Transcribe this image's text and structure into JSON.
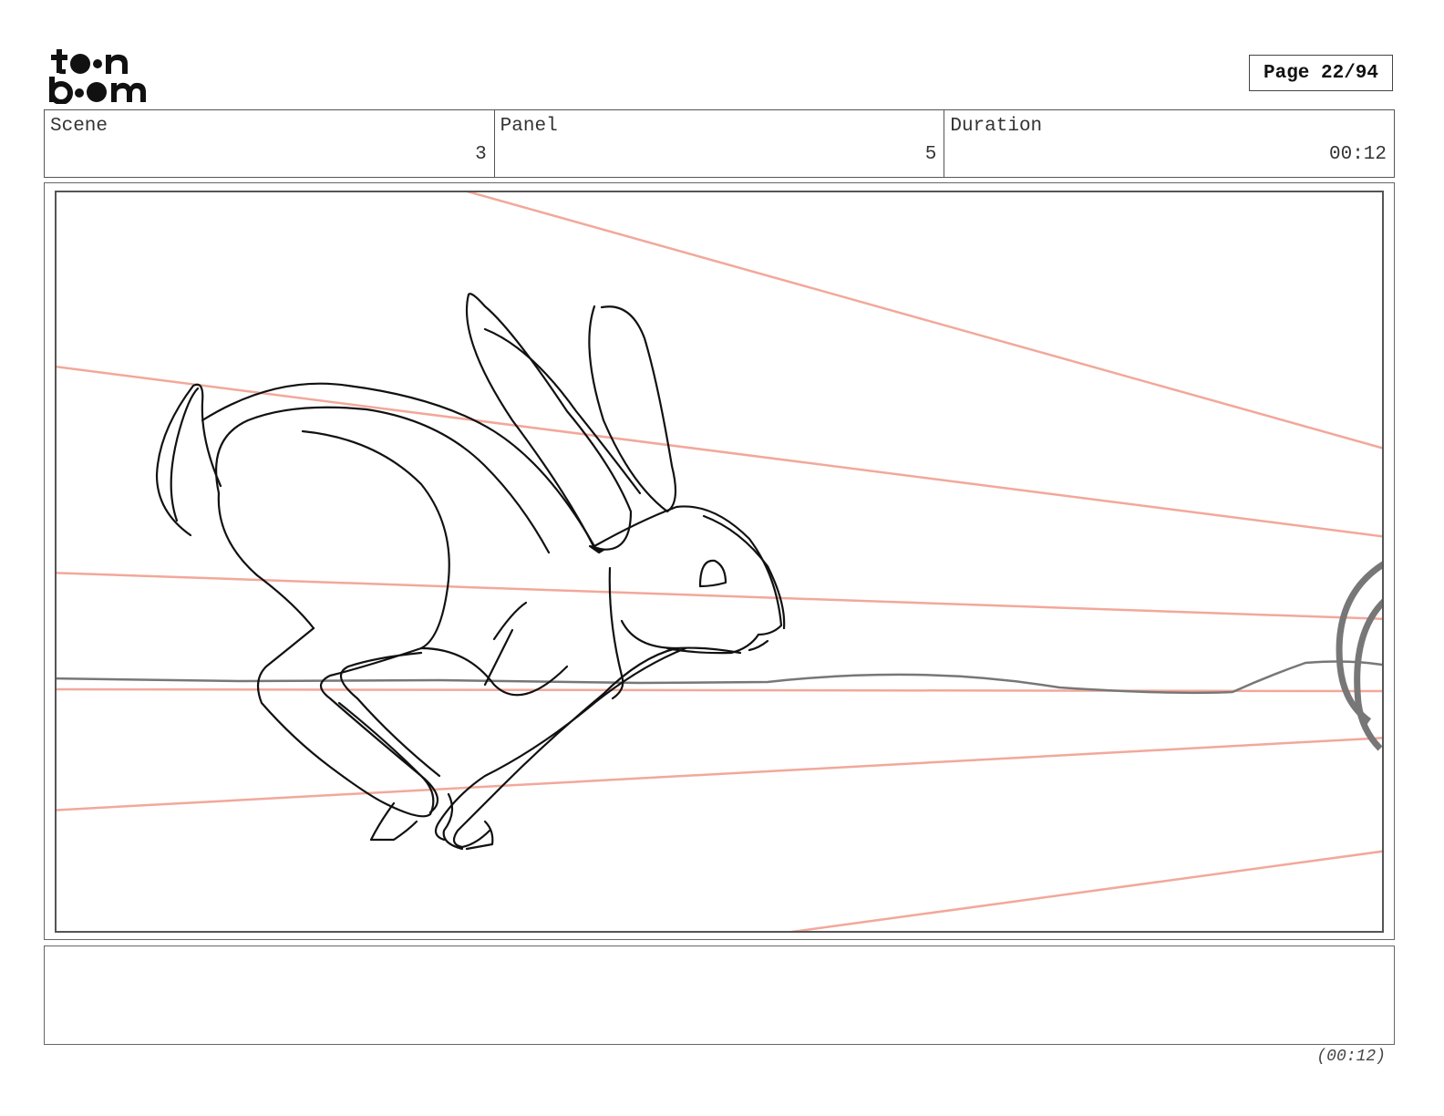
{
  "header": {
    "logo_text": "toon boom",
    "page_label": "Page 22/94"
  },
  "info": {
    "scene_label": "Scene",
    "scene_value": "3",
    "panel_label": "Panel",
    "panel_value": "5",
    "duration_label": "Duration",
    "duration_value": "00:12"
  },
  "panel": {
    "description": "",
    "guide_line_color": "#f2a89a",
    "sketch_color": "#111111"
  },
  "notes": {
    "text": ""
  },
  "footer": {
    "duration": "(00:12)"
  }
}
